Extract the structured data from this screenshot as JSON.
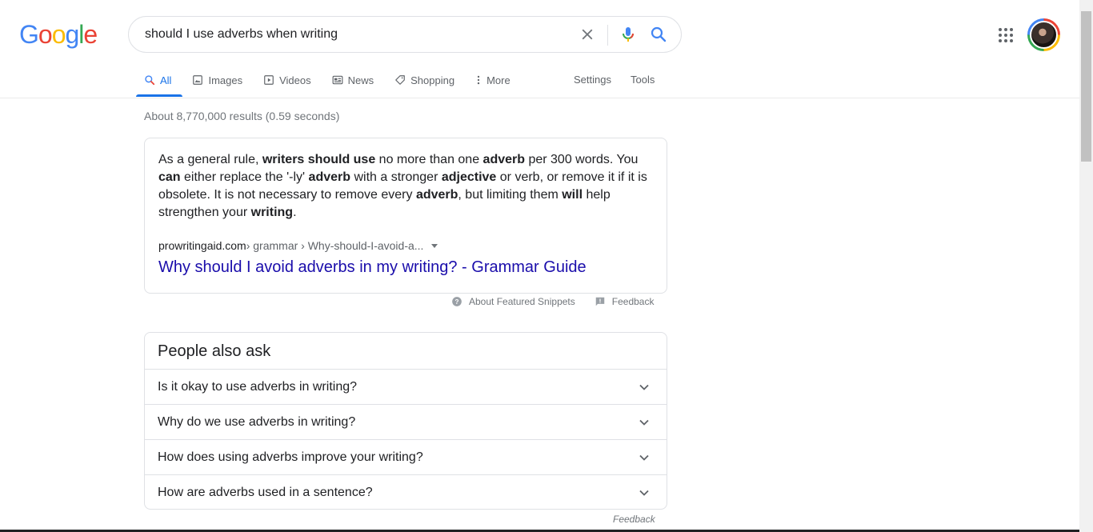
{
  "logo": {
    "letters": [
      "G",
      "o",
      "o",
      "g",
      "l",
      "e"
    ],
    "colors": [
      "#4285f4",
      "#ea4335",
      "#fbbc05",
      "#4285f4",
      "#34a853",
      "#ea4335"
    ]
  },
  "search": {
    "query": "should I use adverbs when writing"
  },
  "tabs": [
    {
      "label": "All",
      "icon": "search-icon",
      "active": true
    },
    {
      "label": "Images",
      "icon": "image-icon"
    },
    {
      "label": "Videos",
      "icon": "play-icon"
    },
    {
      "label": "News",
      "icon": "news-icon"
    },
    {
      "label": "Shopping",
      "icon": "tag-icon"
    },
    {
      "label": "More",
      "icon": "more-vert-icon"
    }
  ],
  "tools": {
    "settings": "Settings",
    "tools": "Tools"
  },
  "stats": "About 8,770,000 results (0.59 seconds)",
  "snippet": {
    "segments": [
      {
        "t": "As a general rule, ",
        "b": false
      },
      {
        "t": "writers should use",
        "b": true
      },
      {
        "t": " no more than one ",
        "b": false
      },
      {
        "t": "adverb",
        "b": true
      },
      {
        "t": " per 300 words. You ",
        "b": false
      },
      {
        "t": "can",
        "b": true
      },
      {
        "t": " either replace the '-ly' ",
        "b": false
      },
      {
        "t": "adverb",
        "b": true
      },
      {
        "t": " with a stronger ",
        "b": false
      },
      {
        "t": "adjective",
        "b": true
      },
      {
        "t": " or verb, or remove it if it is obsolete. It is not necessary to remove every ",
        "b": false
      },
      {
        "t": "adverb",
        "b": true
      },
      {
        "t": ", but limiting them ",
        "b": false
      },
      {
        "t": "will",
        "b": true
      },
      {
        "t": " help strengthen your ",
        "b": false
      },
      {
        "t": "writing",
        "b": true
      },
      {
        "t": ".",
        "b": false
      }
    ],
    "site": "prowritingaid.com",
    "path": " › grammar › Why-should-I-avoid-a...",
    "title": "Why should I avoid adverbs in my writing? - Grammar Guide"
  },
  "snippet_meta": {
    "about": "About Featured Snippets",
    "feedback": "Feedback"
  },
  "paa": {
    "title": "People also ask",
    "questions": [
      "Is it okay to use adverbs in writing?",
      "Why do we use adverbs in writing?",
      "How does using adverbs improve your writing?",
      "How are adverbs used in a sentence?"
    ],
    "feedback": "Feedback"
  }
}
